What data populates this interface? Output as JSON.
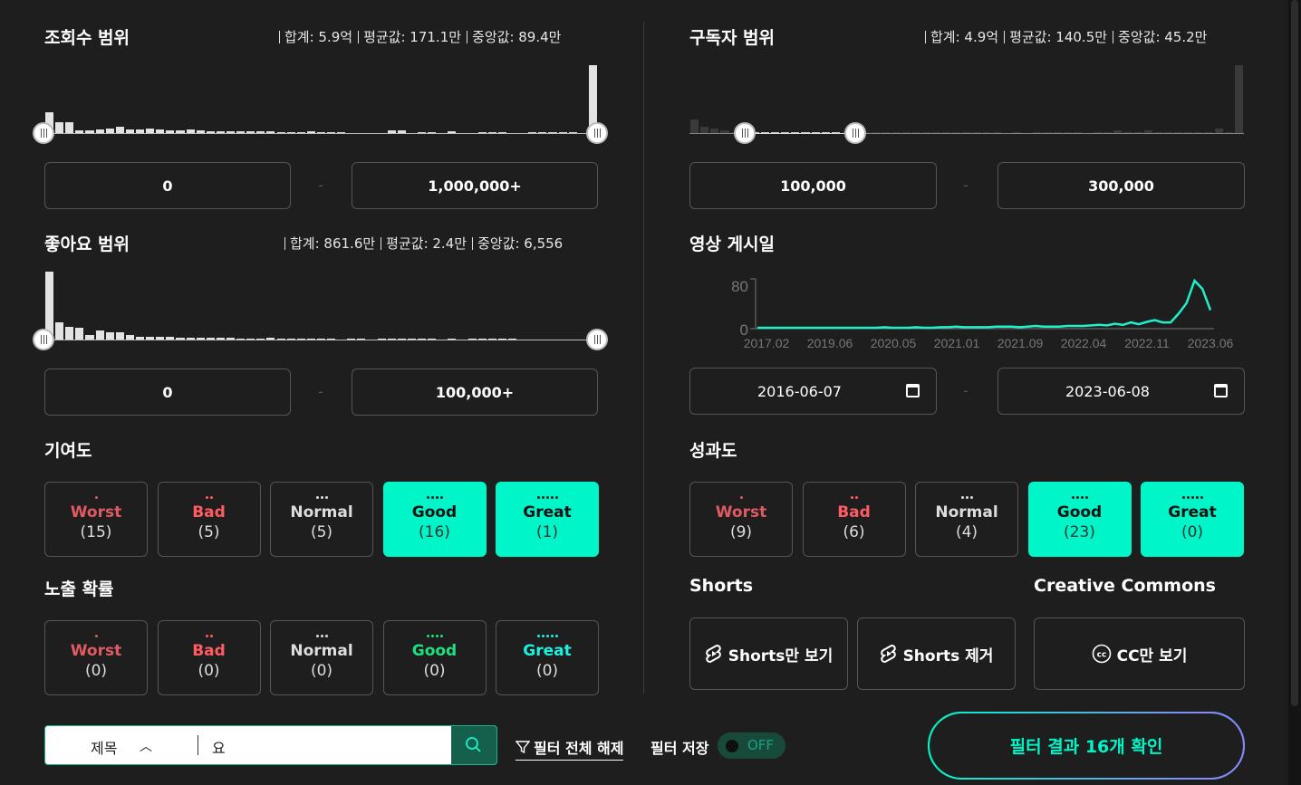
{
  "views": {
    "title": "조회수 범위",
    "sum": "합계: 5.9억",
    "avg": "평균값: 171.1만",
    "median": "중앙값: 89.4만",
    "min": "0",
    "max": "1,000,000+",
    "hist": [
      22,
      12,
      12,
      4,
      4,
      5,
      6,
      7,
      5,
      5,
      6,
      5,
      4,
      4,
      5,
      4,
      3,
      3,
      3,
      3,
      3,
      3,
      3,
      2,
      2,
      2,
      3,
      2,
      2,
      2,
      0,
      0,
      0,
      0,
      4,
      4,
      0,
      2,
      2,
      0,
      3,
      0,
      0,
      2,
      2,
      2,
      0,
      0,
      2,
      2,
      2,
      2,
      2,
      0,
      70
    ]
  },
  "subscribers": {
    "title": "구독자 범위",
    "sum": "합계: 4.9억",
    "avg": "평균값: 140.5만",
    "median": "중앙값: 45.2만",
    "min": "100,000",
    "max": "300,000",
    "hist": [
      16,
      8,
      6,
      4,
      2,
      2,
      2,
      2,
      2,
      2,
      2,
      2,
      2,
      2,
      2,
      2,
      2,
      2,
      2,
      2,
      2,
      2,
      2,
      2,
      2,
      2,
      2,
      2,
      2,
      2,
      2,
      0,
      2,
      0,
      2,
      2,
      2,
      2,
      2,
      0,
      2,
      2,
      4,
      2,
      2,
      4,
      2,
      2,
      2,
      2,
      2,
      2,
      6,
      2,
      74
    ]
  },
  "likes": {
    "title": "좋아요 범위",
    "sum": "합계: 861.6만",
    "avg": "평균값: 2.4만",
    "median": "중앙값: 6,556",
    "min": "0",
    "max": "100,000+",
    "hist": [
      75,
      20,
      15,
      14,
      6,
      11,
      9,
      9,
      6,
      4,
      4,
      4,
      4,
      3,
      3,
      3,
      3,
      3,
      3,
      2,
      2,
      2,
      3,
      2,
      2,
      2,
      2,
      2,
      2,
      0,
      2,
      2,
      0,
      2,
      2,
      2,
      2,
      2,
      2,
      0,
      2,
      0,
      2,
      2,
      2,
      2,
      2,
      0,
      0,
      0,
      0,
      0,
      0,
      0,
      0
    ]
  },
  "upload": {
    "title": "영상 게시일",
    "ymax": "80",
    "ymin": "0",
    "ticks": [
      "2017.02",
      "2019.06",
      "2020.05",
      "2021.01",
      "2021.09",
      "2022.04",
      "2022.11",
      "2023.06"
    ],
    "from": "2016-06-07",
    "to": "2023-06-08",
    "series": [
      0,
      0,
      0,
      0,
      0,
      0,
      0,
      0,
      0,
      0,
      0,
      0,
      0,
      0,
      0,
      0,
      1,
      0,
      0,
      0,
      1,
      0,
      0,
      1,
      1,
      2,
      1,
      1,
      1,
      1,
      2,
      2,
      2,
      1,
      2,
      3,
      2,
      2,
      2,
      3,
      3,
      3,
      4,
      5,
      4,
      7,
      5,
      9,
      6,
      10,
      13,
      9,
      9,
      24,
      42,
      80,
      66,
      30
    ]
  },
  "contribution": {
    "title": "기여도",
    "grades": [
      {
        "name": "Worst",
        "count": "(15)",
        "cls": "worst",
        "dots": 1,
        "active": false
      },
      {
        "name": "Bad",
        "count": "(5)",
        "cls": "bad",
        "dots": 2,
        "active": false
      },
      {
        "name": "Normal",
        "count": "(5)",
        "cls": "normal",
        "dots": 3,
        "active": false
      },
      {
        "name": "Good",
        "count": "(16)",
        "cls": "good",
        "dots": 4,
        "active": true
      },
      {
        "name": "Great",
        "count": "(1)",
        "cls": "great",
        "dots": 5,
        "active": true
      }
    ]
  },
  "performance": {
    "title": "성과도",
    "grades": [
      {
        "name": "Worst",
        "count": "(9)",
        "cls": "worst",
        "dots": 1,
        "active": false
      },
      {
        "name": "Bad",
        "count": "(6)",
        "cls": "bad",
        "dots": 2,
        "active": false
      },
      {
        "name": "Normal",
        "count": "(4)",
        "cls": "normal",
        "dots": 3,
        "active": false
      },
      {
        "name": "Good",
        "count": "(23)",
        "cls": "good",
        "dots": 4,
        "active": true
      },
      {
        "name": "Great",
        "count": "(0)",
        "cls": "great",
        "dots": 5,
        "active": true
      }
    ]
  },
  "exposure": {
    "title": "노출 확률",
    "grades": [
      {
        "name": "Worst",
        "count": "(0)",
        "cls": "worst",
        "dots": 1,
        "active": false
      },
      {
        "name": "Bad",
        "count": "(0)",
        "cls": "bad",
        "dots": 2,
        "active": false
      },
      {
        "name": "Normal",
        "count": "(0)",
        "cls": "normal",
        "dots": 3,
        "active": false
      },
      {
        "name": "Good",
        "count": "(0)",
        "cls": "good",
        "dots": 4,
        "active": false
      },
      {
        "name": "Great",
        "count": "(0)",
        "cls": "great",
        "dots": 5,
        "active": false
      }
    ]
  },
  "shorts": {
    "title": "Shorts",
    "only": "Shorts만 보기",
    "exclude": "Shorts 제거"
  },
  "cc": {
    "title": "Creative Commons",
    "only": "CC만 보기"
  },
  "search": {
    "field": "제목",
    "query": "요"
  },
  "footer": {
    "reset": "필터 전체 해제",
    "save": "필터 저장",
    "toggle": "OFF",
    "cta": "필터 결과 16개 확인"
  },
  "colors": {
    "accent": "#00f5c8",
    "worst": "#e05a63",
    "bad": "#ff5c63",
    "good": "#1fe07e",
    "great": "#1ff0e0"
  }
}
